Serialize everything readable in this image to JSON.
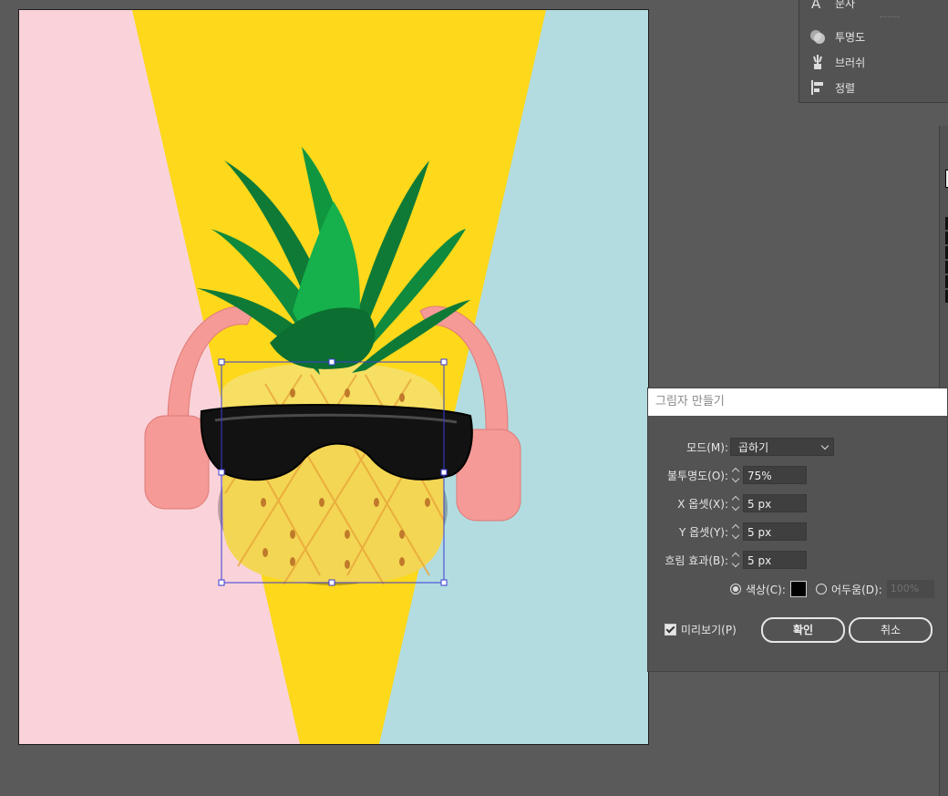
{
  "panel": {
    "items": [
      {
        "label": "문자",
        "icon": "type-icon"
      },
      {
        "label": "투명도",
        "icon": "transparency-icon"
      },
      {
        "label": "브러쉬",
        "icon": "brush-icon"
      },
      {
        "label": "정렬",
        "icon": "align-icon"
      }
    ]
  },
  "dialog": {
    "title": "그림자 만들기",
    "mode_label": "모드(M):",
    "mode_value": "곱하기",
    "opacity_label": "불투명도(O):",
    "opacity_value": "75%",
    "x_offset_label": "X 옵셋(X):",
    "x_offset_value": "5 px",
    "y_offset_label": "Y 옵셋(Y):",
    "y_offset_value": "5 px",
    "blur_label": "흐림 효과(B):",
    "blur_value": "5 px",
    "color_label": "색상(C):",
    "color_value": "#000000",
    "darkness_label": "어두움(D):",
    "darkness_value": "100%",
    "preview_label": "미리보기(P)",
    "preview_checked": true,
    "ok_label": "확인",
    "cancel_label": "취소"
  },
  "colors": {
    "app_background": "#5a5a5a",
    "canvas_pink": "#f9d3d9",
    "canvas_yellow": "#fdd81b",
    "canvas_blue": "#b2dce0",
    "selection": "#3b3bd6"
  }
}
